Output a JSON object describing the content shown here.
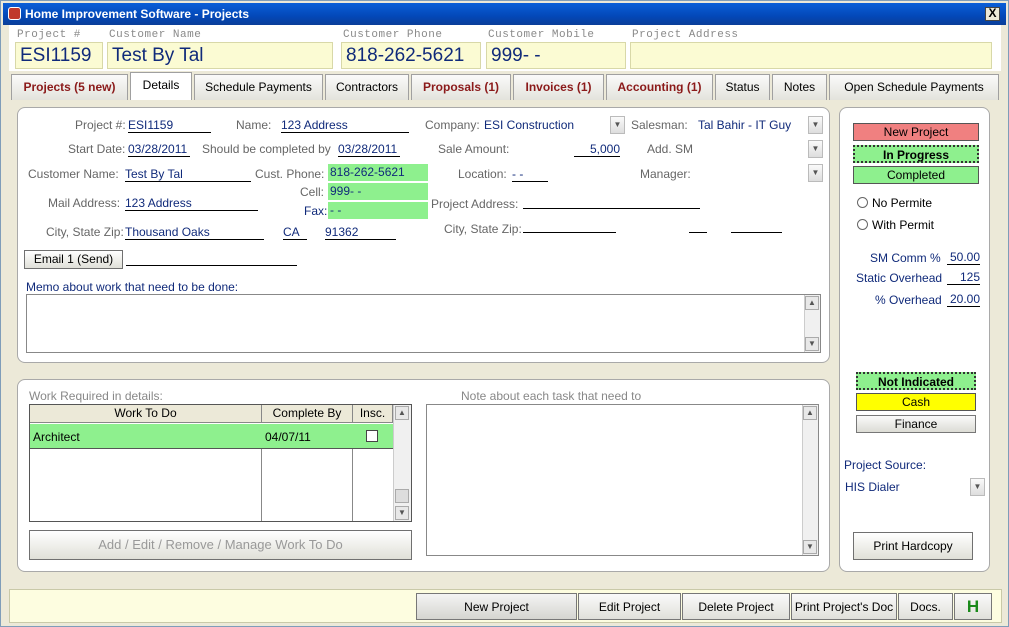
{
  "window": {
    "title": "Home Improvement Software - Projects",
    "close": "X"
  },
  "header": {
    "project_num_label": "Project #",
    "project_num": "ESI1159",
    "customer_name_label": "Customer Name",
    "customer_name": "Test By Tal",
    "customer_phone_label": "Customer Phone",
    "customer_phone": "818-262-5621",
    "customer_mobile_label": "Customer Mobile",
    "customer_mobile": "999-  -",
    "project_address_label": "Project Address",
    "project_address": ""
  },
  "tabs": [
    "Projects (5 new)",
    "Details",
    "Schedule Payments",
    "Contractors",
    "Proposals (1)",
    "Invoices (1)",
    "Accounting (1)",
    "Status",
    "Notes",
    "Open Schedule Payments"
  ],
  "details": {
    "project_num_label": "Project #:",
    "project_num": "ESI1159",
    "name_label": "Name:",
    "name": "123 Address",
    "company_label": "Company:",
    "company": "ESI Construction",
    "salesman_label": "Salesman:",
    "salesman": "Tal Bahir - IT Guy",
    "start_date_label": "Start Date:",
    "start_date": "03/28/2011",
    "complete_by_label": "Should be completed by",
    "complete_by": "03/28/2011",
    "sale_amount_label": "Sale Amount:",
    "sale_amount": "5,000",
    "add_sm_label": "Add. SM",
    "customer_name_label": "Customer Name:",
    "customer_name": "Test By Tal",
    "cust_phone_label": "Cust. Phone:",
    "cust_phone": "818-262-5621",
    "location_label": "Location:",
    "location": " -  - ",
    "manager_label": "Manager:",
    "cell_label": "Cell:",
    "cell": "999-  -",
    "fax_label": "Fax:",
    "fax": "  -  -",
    "mail_address_label": "Mail Address:",
    "mail_address": "123 Address",
    "project_address_label": "Project Address:",
    "city_state_zip_label": "City, State Zip:",
    "city": "Thousand Oaks",
    "state": "CA",
    "zip": "91362",
    "proj_city_state_zip_label": "City, State Zip:",
    "email_button": "Email 1 (Send)",
    "memo_label": "Memo about work that need to be done:"
  },
  "status_panel": {
    "new_project": "New Project",
    "in_progress": "In Progress",
    "completed": "Completed",
    "no_permite": "No Permite",
    "with_permit": "With Permit",
    "sm_comm_label": "SM Comm %",
    "sm_comm": "50.00",
    "static_overhead_label": "Static Overhead",
    "static_overhead": "125",
    "pct_overhead_label": "% Overhead",
    "pct_overhead": "20.00",
    "not_indicated": "Not Indicated",
    "cash": "Cash",
    "finance": "Finance",
    "project_source_label": "Project Source:",
    "project_source": "HIS Dialer",
    "print_hardcopy": "Print Hardcopy"
  },
  "work": {
    "label": "Work Required in details:",
    "columns": [
      "Work To Do",
      "Complete By",
      "Insc."
    ],
    "rows": [
      {
        "work": "Architect",
        "complete_by": "04/07/11"
      }
    ],
    "manage_button": "Add / Edit / Remove / Manage Work To Do",
    "note_label": "Note about each task that need to"
  },
  "footer": {
    "new_project": "New Project",
    "edit_project": "Edit Project",
    "delete_project": "Delete Project",
    "print_doc": "Print Project's Doc",
    "docs": "Docs.",
    "h": "H"
  },
  "colors": {
    "green": "#8ef08e",
    "red_button": "#f08080",
    "yellow": "#ffff00",
    "tab_red": "#8b1a1a",
    "value_blue": "#102a7a"
  }
}
